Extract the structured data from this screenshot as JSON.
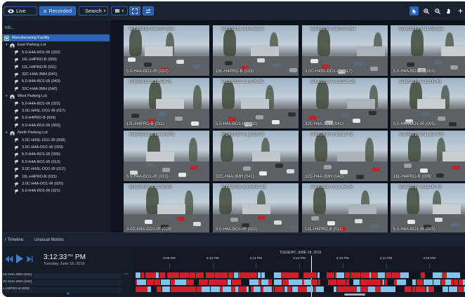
{
  "toolbar": {
    "live_label": "Live",
    "recorded_label": "Recorded",
    "search_label": "Search"
  },
  "sidebar": {
    "search_placeholder": "rch...",
    "items": [
      {
        "label": "Manufacturing Facility",
        "level": 0,
        "kind": "site",
        "selected": true
      },
      {
        "label": "East Parking Lot",
        "level": 1,
        "kind": "group"
      },
      {
        "label": "5.0-H4A-BO1-IR (032)",
        "level": 2,
        "kind": "camera"
      },
      {
        "label": "16L-H4PRO-B (009)",
        "level": 2,
        "kind": "camera"
      },
      {
        "label": "12L-H4PRO-B (011)",
        "level": 2,
        "kind": "camera"
      },
      {
        "label": "32C-H4A-3MH (041)",
        "level": 2,
        "kind": "camera"
      },
      {
        "label": "5.0-H4A-BO1-IR (043)",
        "level": 2,
        "kind": "camera"
      },
      {
        "label": "32C-H4A-3MH (042)",
        "level": 2,
        "kind": "camera"
      },
      {
        "label": "West Parking Lot",
        "level": 1,
        "kind": "group"
      },
      {
        "label": "5.0-H4A-BO1-IR (022)",
        "level": 2,
        "kind": "camera"
      },
      {
        "label": "3.0C-H4SL-DO1-IR (017)",
        "level": 2,
        "kind": "camera"
      },
      {
        "label": "5.0-H4PRO-B (004)",
        "level": 2,
        "kind": "camera"
      },
      {
        "label": "5.0-H4A-BO1-IR (003)",
        "level": 2,
        "kind": "camera"
      },
      {
        "label": "North Parking Lot",
        "level": 1,
        "kind": "group"
      },
      {
        "label": "3.0C-H4SL-DO1-IR (008)",
        "level": 2,
        "kind": "camera"
      },
      {
        "label": "3.0C-H4A-DO1-IR (029)",
        "level": 2,
        "kind": "camera"
      },
      {
        "label": "5.0-H4A-BO1-IR (005)",
        "level": 2,
        "kind": "camera"
      },
      {
        "label": "5.0-H4A-BO1-IR (013)",
        "level": 2,
        "kind": "camera"
      },
      {
        "label": "3.0C-H4SL-DO1-IR (012)",
        "level": 2,
        "kind": "camera"
      },
      {
        "label": "16L-H4PRO-B (015)",
        "level": 2,
        "kind": "camera"
      },
      {
        "label": "3.0C-H4A-DO1-IR (020)",
        "level": 2,
        "kind": "camera"
      },
      {
        "label": "5.0-H4A-BO1-IR (021)",
        "level": 2,
        "kind": "camera"
      }
    ]
  },
  "cameras": [
    {
      "timestamp": "6/19/2019 3:10:07:234",
      "name": "5.0-H4A-BO1-IR (032)"
    },
    {
      "timestamp": "6/19/2019 3:10:40:19",
      "name": "16L-H4PRO-B (015)"
    },
    {
      "timestamp": "6/19/2019 3:10:07:234",
      "name": "3.0C-H4SL-DO1-IR (017)"
    },
    {
      "timestamp": "6/19/2019 3:11:02:384",
      "name": "5.0-H4A-BO1-IR (003)"
    },
    {
      "timestamp": "6/19/2019 3:11:53:73",
      "name": "12L-H4PRO-B (011)"
    },
    {
      "timestamp": "6/19/2019 3:13:06:35",
      "name": "5.0-H4A-BO1-IR (032)"
    },
    {
      "timestamp": "6/19/2019 3:13:53:126",
      "name": "32C-H4A-3MH (041)"
    },
    {
      "timestamp": "6/19/2019 3:12:00:43",
      "name": "5.0-H4A-BO1-IR (005)"
    },
    {
      "timestamp": "6/19/2019 3:12:18:273",
      "name": "5.0-H4A-BO1-IR (013)"
    },
    {
      "timestamp": "6/19/2019 3:12:33:73",
      "name": "32C-H4A-3MH (041)"
    },
    {
      "timestamp": "6/19/2019 3:12:13:73",
      "name": "32C-H4A-3MH (042)"
    },
    {
      "timestamp": "6/19/2019 3:11:18:173",
      "name": "16L-H4PRO-B (009)"
    },
    {
      "timestamp": "6/19/2019 3:13:35:63",
      "name": "3.0C-H4A-DO1-IR (029)"
    },
    {
      "timestamp": "6/19/2019 3:13:53:712",
      "name": "5.0-H4A-BO1-IR (022)"
    },
    {
      "timestamp": "6/19/2019 3:14:46:25",
      "name": "12L-H4PRO-B (011)"
    },
    {
      "timestamp": "6/19/2019 3:12:00:43",
      "name": "5.0-H4A-BO1-IR (003)"
    }
  ],
  "filter": {
    "label": "r Timeline:",
    "value": "Unusual Motion"
  },
  "playback": {
    "time": "3:12:33",
    "time_ms": ":051",
    "ampm": "PM",
    "date": "Tuesday, June 18, 2019"
  },
  "tracks": [
    {
      "label": "2C-H4A-3MH (041)"
    },
    {
      "label": "2C-H4A-3MH (042)"
    },
    {
      "label": "L-H4PRO-B (009)"
    }
  ],
  "timeline": {
    "date_label": "TUESDAY, JUNE 18, 2019",
    "ticks": [
      "3:09 PM",
      "3:10 PM",
      "3:11 PM",
      "3:12 PM",
      "3:13 PM",
      "3:14 PM",
      "3:15 PM",
      "3:16 PM"
    ],
    "motion_color": "#d11f2a",
    "recording_color": "#7fc4ea"
  },
  "colors": {
    "accent": "#2b63b8",
    "background": "#141b27"
  }
}
